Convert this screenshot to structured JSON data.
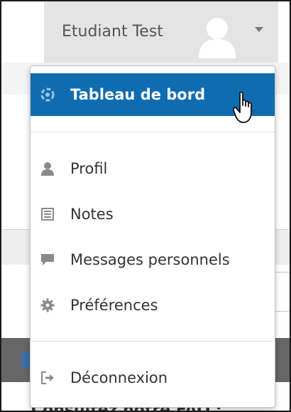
{
  "header": {
    "user_name": "Etudiant Test"
  },
  "menu": {
    "items": [
      {
        "label": "Tableau de bord",
        "icon": "dashboard-icon",
        "active": true
      },
      {
        "label": "Profil",
        "icon": "user-icon"
      },
      {
        "label": "Notes",
        "icon": "grades-icon"
      },
      {
        "label": "Messages personnels",
        "icon": "message-icon"
      },
      {
        "label": "Préférences",
        "icon": "gear-icon"
      },
      {
        "label": "Déconnexion",
        "icon": "logout-icon"
      }
    ]
  },
  "background": {
    "partial_text": "Consultez notre FAQ :"
  },
  "colors": {
    "active_bg": "#0f6cb0",
    "icon_gray": "#8a8a8a",
    "text": "#333333"
  }
}
